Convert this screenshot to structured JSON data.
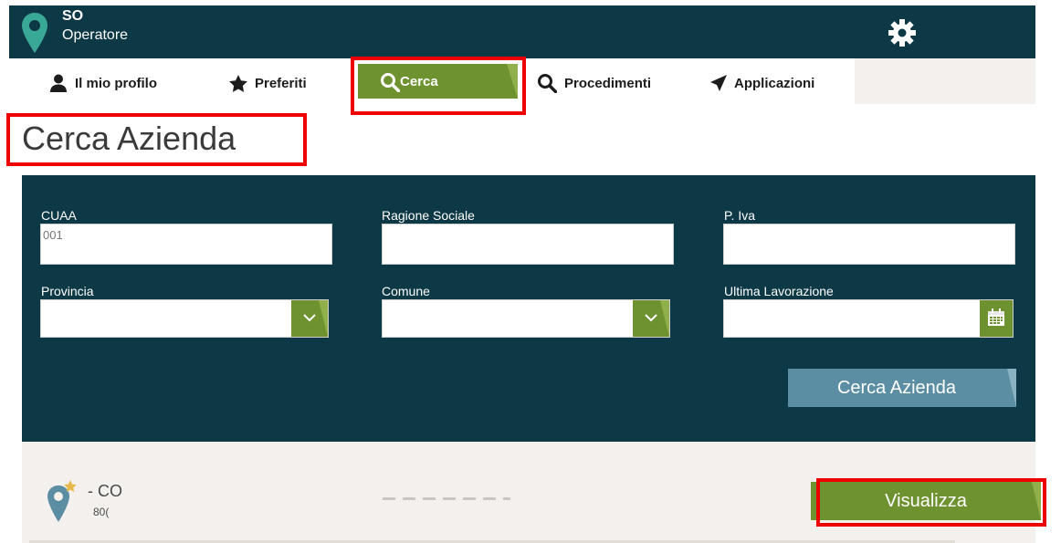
{
  "header": {
    "role": "SO",
    "user": "Operatore",
    "icons": {
      "logo": "map-pin-icon",
      "settings": "gear-icon"
    }
  },
  "nav": {
    "items": [
      {
        "label": "Il mio profilo",
        "icon": "user-icon"
      },
      {
        "label": "Preferiti",
        "icon": "star-icon"
      },
      {
        "label": "Cerca",
        "icon": "search-icon",
        "active": true
      },
      {
        "label": "Procedimenti",
        "icon": "search-icon"
      },
      {
        "label": "Applicazioni",
        "icon": "paper-plane-icon"
      }
    ]
  },
  "page": {
    "title": "Cerca Azienda"
  },
  "search": {
    "cuaa_label": "CUAA",
    "cuaa_value": "001",
    "ragione_label": "Ragione Sociale",
    "ragione_value": "",
    "piva_label": "P. Iva",
    "piva_value": "",
    "provincia_label": "Provincia",
    "provincia_value": "",
    "comune_label": "Comune",
    "comune_value": "",
    "lavorazione_label": "Ultima Lavorazione",
    "lavorazione_value": "",
    "submit": "Cerca Azienda"
  },
  "results": [
    {
      "name": "- CO",
      "code": "80(",
      "action": "Visualizza"
    }
  ],
  "colors": {
    "header": "#0d3845",
    "accent_green": "#6f9230",
    "button_blue": "#5b8ea2",
    "highlight": "#ee0000"
  }
}
